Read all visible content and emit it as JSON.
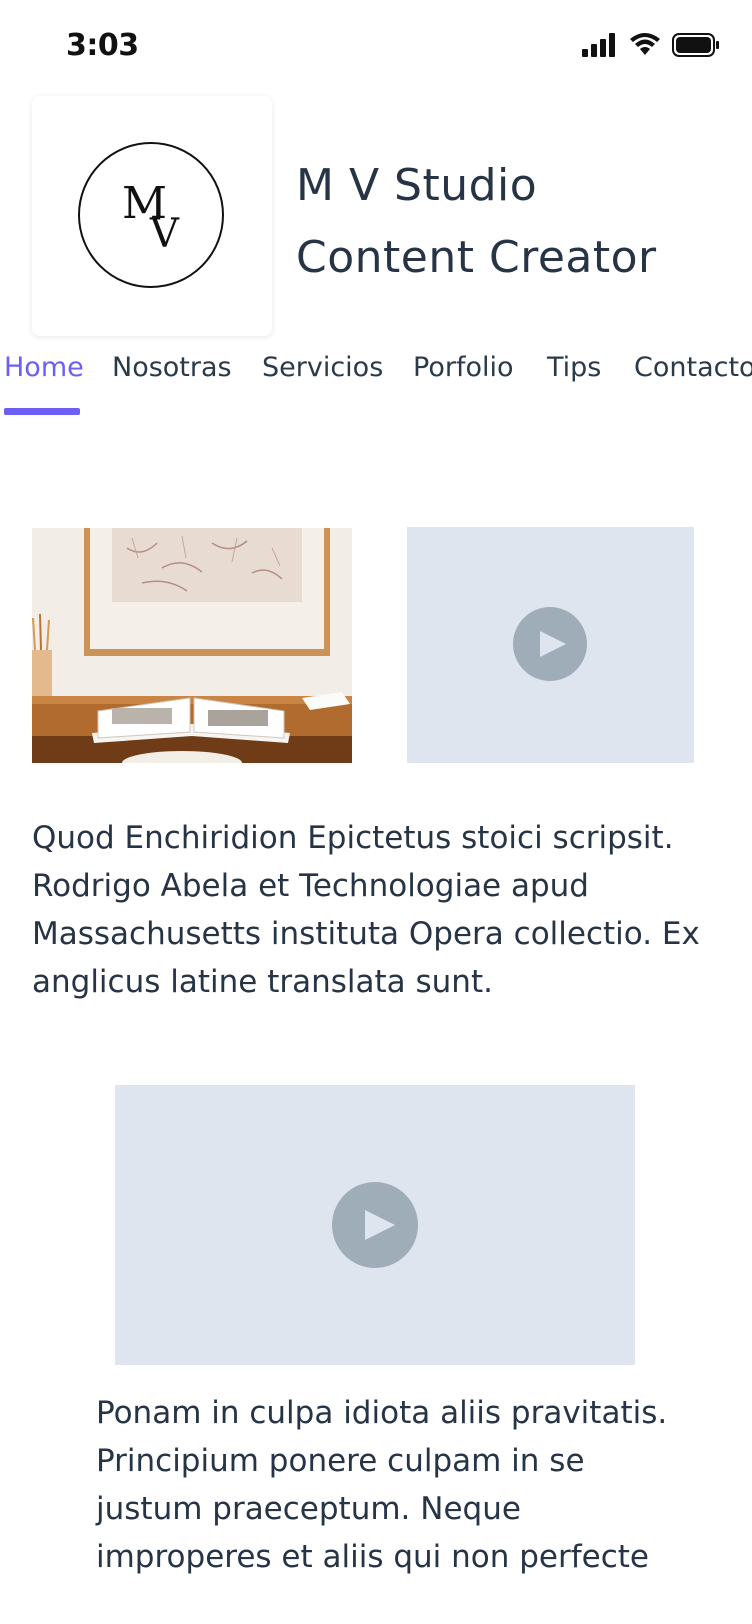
{
  "status_bar": {
    "time": "3:03"
  },
  "header": {
    "logo_letters": [
      "M",
      "V"
    ],
    "title_line1": "M V Studio",
    "title_line2": "Content Creator"
  },
  "nav": {
    "items": [
      {
        "label": "Home",
        "active": true
      },
      {
        "label": "Nosotras",
        "active": false
      },
      {
        "label": "Servicios",
        "active": false
      },
      {
        "label": "Porfolio",
        "active": false
      },
      {
        "label": "Tips",
        "active": false
      },
      {
        "label": "Contacto",
        "active": false
      }
    ]
  },
  "content": {
    "paragraph1": "Quod Enchiridion Epictetus stoici scripsit. Rodrigo Abela et Technologiae apud Massachusetts instituta Opera collectio. Ex anglicus latine translata sunt.",
    "paragraph2": "Ponam in culpa idiota aliis pravitatis. Principium ponere culpam in se justum praeceptum. Neque improperes et aliis qui non perfecte"
  },
  "colors": {
    "accent": "#6b5ff5",
    "text": "#263445",
    "video_bg": "#dfe5ee",
    "play": "#9eadb8"
  }
}
